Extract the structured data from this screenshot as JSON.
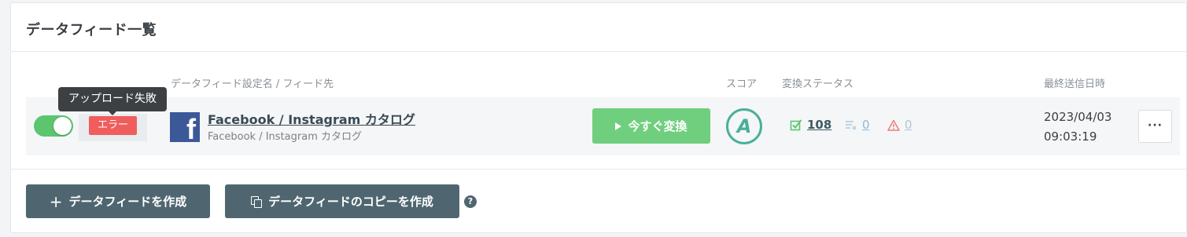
{
  "panel": {
    "title": "データフィード一覧"
  },
  "columns": {
    "feed_setting": "データフィード設定名 / フィード先",
    "score": "スコア",
    "convert_status": "変換ステータス",
    "last_sent": "最終送信日時"
  },
  "row": {
    "toggle_on": true,
    "tooltip": "アップロード失敗",
    "status_badge": "エラー",
    "icon": "facebook-icon",
    "feed_name": "Facebook / Instagram カタログ",
    "feed_destination": "Facebook / Instagram カタログ",
    "convert_button": "今すぐ変換",
    "score": "A",
    "stats": {
      "success": "108",
      "skipped": "0",
      "warning": "0"
    },
    "last_sent_date": "2023/04/03",
    "last_sent_time": "09:03:19",
    "more_label": "···"
  },
  "actions": {
    "create_label": "データフィードを作成",
    "copy_label": "データフィードのコピーを作成",
    "help": "?"
  },
  "colors": {
    "toggle": "#5cc56d",
    "error": "#f05d5d",
    "convert": "#6fcf7e",
    "score": "#4aaf9a",
    "action": "#4f6670"
  }
}
